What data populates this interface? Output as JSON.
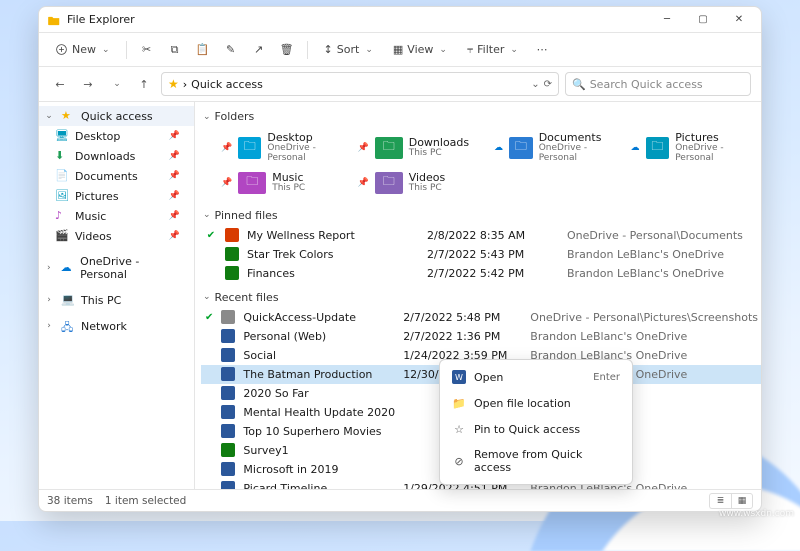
{
  "window": {
    "title": "File Explorer"
  },
  "toolbar": {
    "new": "New",
    "sort": "Sort",
    "view": "View",
    "filter": "Filter"
  },
  "address": {
    "crumb": "Quick access",
    "search_placeholder": "Search Quick access"
  },
  "nav": {
    "quick_access": "Quick access",
    "items": [
      {
        "label": "Desktop",
        "pinned": true
      },
      {
        "label": "Downloads",
        "pinned": true
      },
      {
        "label": "Documents",
        "pinned": true
      },
      {
        "label": "Pictures",
        "pinned": true
      },
      {
        "label": "Music",
        "pinned": true
      },
      {
        "label": "Videos",
        "pinned": true
      }
    ],
    "onedrive": "OneDrive - Personal",
    "this_pc": "This PC",
    "network": "Network"
  },
  "sections": {
    "folders": "Folders",
    "pinned": "Pinned files",
    "recent": "Recent files"
  },
  "folders": [
    {
      "name": "Desktop",
      "sub": "OneDrive - Personal",
      "color": "#00a2d8"
    },
    {
      "name": "Downloads",
      "sub": "This PC",
      "color": "#1f9d55"
    },
    {
      "name": "Documents",
      "sub": "OneDrive - Personal",
      "color": "#2b7cd3"
    },
    {
      "name": "Pictures",
      "sub": "OneDrive - Personal",
      "color": "#0099bc"
    },
    {
      "name": "Music",
      "sub": "This PC",
      "color": "#b146c2"
    },
    {
      "name": "Videos",
      "sub": "This PC",
      "color": "#8764b8"
    }
  ],
  "pinned_files": [
    {
      "sync": true,
      "ic": "#d83b01",
      "name": "My Wellness Report",
      "date": "2/8/2022 8:35 AM",
      "loc": "OneDrive - Personal\\Documents"
    },
    {
      "sync": false,
      "ic": "#107c10",
      "name": "Star Trek Colors",
      "date": "2/7/2022 5:43 PM",
      "loc": "Brandon LeBlanc's OneDrive"
    },
    {
      "sync": false,
      "ic": "#107c10",
      "name": "Finances",
      "date": "2/7/2022 5:42 PM",
      "loc": "Brandon LeBlanc's OneDrive"
    }
  ],
  "recent_files": [
    {
      "sync": true,
      "ic": "#8a8a8a",
      "name": "QuickAccess-Update",
      "date": "2/7/2022 5:48 PM",
      "loc": "OneDrive - Personal\\Pictures\\Screenshots"
    },
    {
      "sync": false,
      "ic": "#2b579a",
      "name": "Personal (Web)",
      "date": "2/7/2022 1:36 PM",
      "loc": "Brandon LeBlanc's OneDrive"
    },
    {
      "sync": false,
      "ic": "#2b579a",
      "name": "Social",
      "date": "1/24/2022 3:59 PM",
      "loc": "Brandon LeBlanc's OneDrive"
    },
    {
      "sync": false,
      "ic": "#2b579a",
      "name": "The Batman Production",
      "date": "12/30/2021 10:51 AM",
      "loc": "Brandon LeBlanc's OneDrive",
      "selected": true
    },
    {
      "sync": false,
      "ic": "#2b579a",
      "name": "2020 So Far",
      "date": "",
      "loc": "n's OneDrive"
    },
    {
      "sync": false,
      "ic": "#2b579a",
      "name": "Mental Health Update 2020",
      "date": "",
      "loc": "n's OneDrive"
    },
    {
      "sync": false,
      "ic": "#2b579a",
      "name": "Top 10 Superhero Movies",
      "date": "",
      "loc": "n's OneDrive"
    },
    {
      "sync": false,
      "ic": "#107c10",
      "name": "Survey1",
      "date": "",
      "loc": "n's OneDrive"
    },
    {
      "sync": false,
      "ic": "#2b579a",
      "name": "Microsoft in 2019",
      "date": "",
      "loc": "n's OneDrive"
    },
    {
      "sync": false,
      "ic": "#2b579a",
      "name": "Picard Timeline",
      "date": "1/29/2022 4:51 PM",
      "loc": "Brandon LeBlanc's OneDrive"
    }
  ],
  "context_menu": {
    "open": "Open",
    "open_hint": "Enter",
    "open_loc": "Open file location",
    "pin": "Pin to Quick access",
    "remove": "Remove from Quick access"
  },
  "status": {
    "count": "38 items",
    "selected": "1 item selected"
  },
  "watermark": "www.wsxdn.com"
}
